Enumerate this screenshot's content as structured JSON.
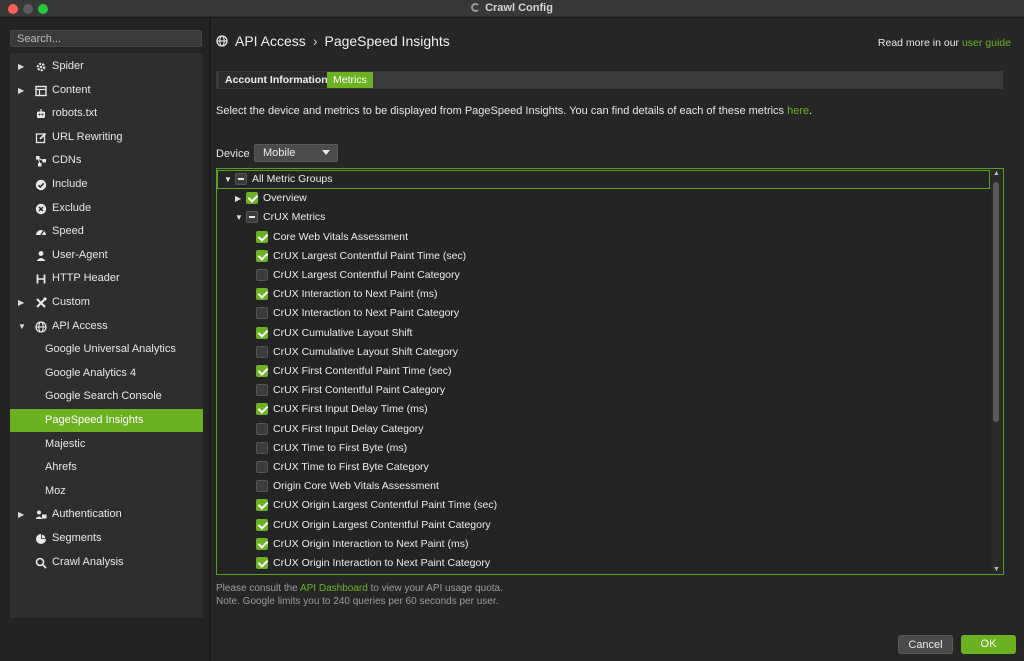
{
  "window": {
    "title": "Crawl Config"
  },
  "sidebar": {
    "search_placeholder": "Search...",
    "items": [
      {
        "label": "Spider",
        "icon": "gear-icon",
        "expandable": true
      },
      {
        "label": "Content",
        "icon": "content-icon",
        "expandable": true
      },
      {
        "label": "robots.txt",
        "icon": "robot-icon"
      },
      {
        "label": "URL Rewriting",
        "icon": "edit-icon"
      },
      {
        "label": "CDNs",
        "icon": "network-icon"
      },
      {
        "label": "Include",
        "icon": "check-circle-icon"
      },
      {
        "label": "Exclude",
        "icon": "x-circle-icon"
      },
      {
        "label": "Speed",
        "icon": "speedometer-icon"
      },
      {
        "label": "User-Agent",
        "icon": "user-agent-icon"
      },
      {
        "label": "HTTP Header",
        "icon": "header-icon"
      },
      {
        "label": "Custom",
        "icon": "tools-icon",
        "expandable": true
      },
      {
        "label": "API Access",
        "icon": "globe-icon",
        "expanded": true
      },
      {
        "label": "Google Universal Analytics",
        "sub": true
      },
      {
        "label": "Google Analytics 4",
        "sub": true
      },
      {
        "label": "Google Search Console",
        "sub": true
      },
      {
        "label": "PageSpeed Insights",
        "sub": true,
        "selected": true
      },
      {
        "label": "Majestic",
        "sub": true
      },
      {
        "label": "Ahrefs",
        "sub": true
      },
      {
        "label": "Moz",
        "sub": true
      },
      {
        "label": "Authentication",
        "icon": "users-icon",
        "expandable": true
      },
      {
        "label": "Segments",
        "icon": "pie-icon"
      },
      {
        "label": "Crawl Analysis",
        "icon": "search-icon"
      }
    ]
  },
  "header": {
    "breadcrumb_root": "API Access",
    "breadcrumb_sep": "›",
    "breadcrumb_page": "PageSpeed Insights",
    "read_more_text": "Read more in our",
    "read_more_link": "user guide"
  },
  "tabs": [
    {
      "label": "Account Information"
    },
    {
      "label": "Metrics",
      "active": true
    }
  ],
  "intro": {
    "text": "Select the device and metrics to be displayed from PageSpeed Insights. You can find details of each of these metrics",
    "link": "here",
    "end": "."
  },
  "device": {
    "label": "Device",
    "value": "Mobile"
  },
  "metrics": [
    {
      "label": "All Metric Groups",
      "level": 0,
      "arrow": "▼",
      "state": "part"
    },
    {
      "label": "Overview",
      "level": 1,
      "arrow": "▶",
      "state": "on"
    },
    {
      "label": "CrUX Metrics",
      "level": 1,
      "arrow": "▼",
      "state": "part"
    },
    {
      "label": "Core Web Vitals Assessment",
      "level": 2,
      "state": "on"
    },
    {
      "label": "CrUX Largest Contentful Paint Time (sec)",
      "level": 2,
      "state": "on"
    },
    {
      "label": "CrUX Largest Contentful Paint Category",
      "level": 2,
      "state": "off"
    },
    {
      "label": "CrUX Interaction to Next Paint (ms)",
      "level": 2,
      "state": "on"
    },
    {
      "label": "CrUX Interaction to Next Paint Category",
      "level": 2,
      "state": "off"
    },
    {
      "label": "CrUX Cumulative Layout Shift",
      "level": 2,
      "state": "on"
    },
    {
      "label": "CrUX Cumulative Layout Shift Category",
      "level": 2,
      "state": "off"
    },
    {
      "label": "CrUX First Contentful Paint Time (sec)",
      "level": 2,
      "state": "on"
    },
    {
      "label": "CrUX First Contentful Paint Category",
      "level": 2,
      "state": "off"
    },
    {
      "label": "CrUX First Input Delay Time (ms)",
      "level": 2,
      "state": "on"
    },
    {
      "label": "CrUX First Input Delay Category",
      "level": 2,
      "state": "off"
    },
    {
      "label": "CrUX Time to First Byte (ms)",
      "level": 2,
      "state": "off"
    },
    {
      "label": "CrUX Time to First Byte Category",
      "level": 2,
      "state": "off"
    },
    {
      "label": "Origin Core Web Vitals Assessment",
      "level": 2,
      "state": "off"
    },
    {
      "label": "CrUX Origin Largest Contentful Paint Time (sec)",
      "level": 2,
      "state": "on"
    },
    {
      "label": "CrUX Origin Largest Contentful Paint Category",
      "level": 2,
      "state": "on"
    },
    {
      "label": "CrUX Origin Interaction to Next Paint (ms)",
      "level": 2,
      "state": "on"
    },
    {
      "label": "CrUX Origin Interaction to Next Paint Category",
      "level": 2,
      "state": "on"
    }
  ],
  "footer": {
    "note1_pre": "Please consult the",
    "note1_link": "API Dashboard",
    "note1_post": "to view your API usage quota.",
    "note2": "Note. Google limits you to 240 queries per 60 seconds per user."
  },
  "buttons": {
    "cancel": "Cancel",
    "ok": "OK"
  },
  "colors": {
    "accent": "#6cb121",
    "background": "#262626",
    "sidebar": "#232323"
  }
}
